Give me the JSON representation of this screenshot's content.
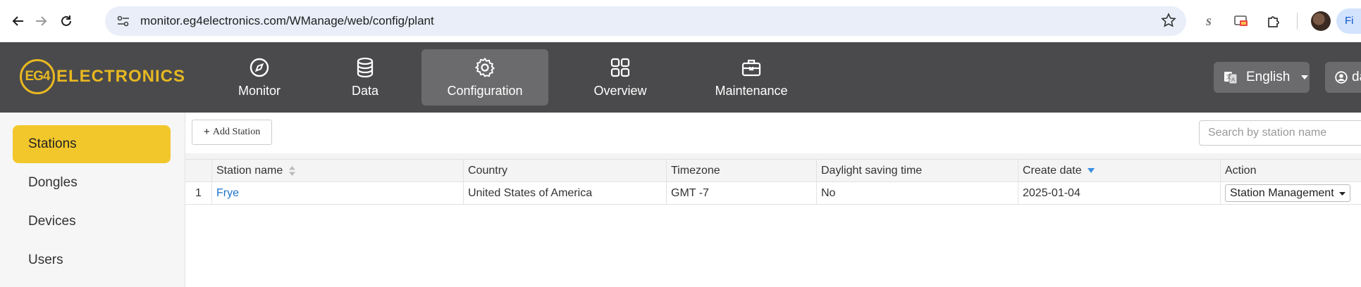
{
  "browser": {
    "url": "monitor.eg4electronics.com/WManage/web/config/plant",
    "profile_label": "Fi"
  },
  "header": {
    "logo_mark": "EG4",
    "logo_text": "ELECTRONICS",
    "nav": [
      {
        "label": "Monitor",
        "icon": "compass-icon"
      },
      {
        "label": "Data",
        "icon": "database-icon"
      },
      {
        "label": "Configuration",
        "icon": "gear-icon",
        "active": true
      },
      {
        "label": "Overview",
        "icon": "grid-icon"
      },
      {
        "label": "Maintenance",
        "icon": "toolbox-icon"
      }
    ],
    "language": "English",
    "user_label": "da"
  },
  "sidebar": {
    "items": [
      {
        "label": "Stations",
        "active": true
      },
      {
        "label": "Dongles"
      },
      {
        "label": "Devices"
      },
      {
        "label": "Users"
      }
    ]
  },
  "toolbar": {
    "add_label": "Add Station",
    "search_placeholder": "Search by station name"
  },
  "table": {
    "columns": [
      "Station name",
      "Country",
      "Timezone",
      "Daylight saving time",
      "Create date",
      "Action"
    ],
    "rows": [
      {
        "index": "1",
        "station_name": "Frye",
        "country": "United States of America",
        "timezone": "GMT -7",
        "daylight_saving": "No",
        "create_date": "2025-01-04",
        "action": "Station Management"
      }
    ]
  },
  "colors": {
    "header_bg": "#4a4a4c",
    "accent_yellow": "#f2c72c",
    "logo_gold": "#e7b821",
    "link_blue": "#1d73c9"
  }
}
